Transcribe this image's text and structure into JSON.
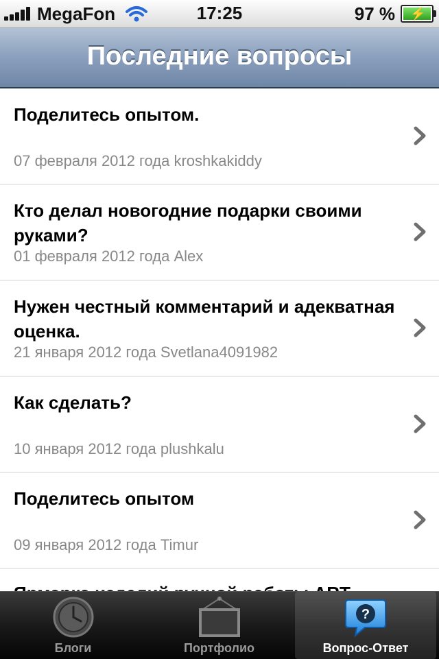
{
  "status_bar": {
    "carrier": "MegaFon",
    "time": "17:25",
    "battery": "97 %"
  },
  "nav": {
    "title": "Последние вопросы"
  },
  "questions": [
    {
      "title": "Поделитесь опытом.",
      "meta": "07 февраля 2012 года kroshkakiddy"
    },
    {
      "title": "Кто делал новогодние подарки своими руками?",
      "meta": "01 февраля 2012 года Alex"
    },
    {
      "title": "Нужен честный комментарий и адекватная оценка.",
      "meta": "21 января 2012 года Svetlana4091982"
    },
    {
      "title": "Как сделать?",
      "meta": "10 января 2012 года plushkalu"
    },
    {
      "title": "Поделитесь опытом",
      "meta": "09 января 2012 года Timur"
    },
    {
      "title": "Ярмарка изделий ручной работы ART",
      "meta": ""
    }
  ],
  "tabs": [
    {
      "label": "Блоги",
      "icon": "clock-icon",
      "active": false
    },
    {
      "label": "Портфолио",
      "icon": "picture-frame-icon",
      "active": false
    },
    {
      "label": "Вопрос-Ответ",
      "icon": "question-bubble-icon",
      "active": true
    }
  ],
  "colors": {
    "nav_top": "#b3c2d6",
    "nav_bottom": "#6e86a6",
    "meta_text": "#888888",
    "tabbar": "#1a1a1a"
  }
}
